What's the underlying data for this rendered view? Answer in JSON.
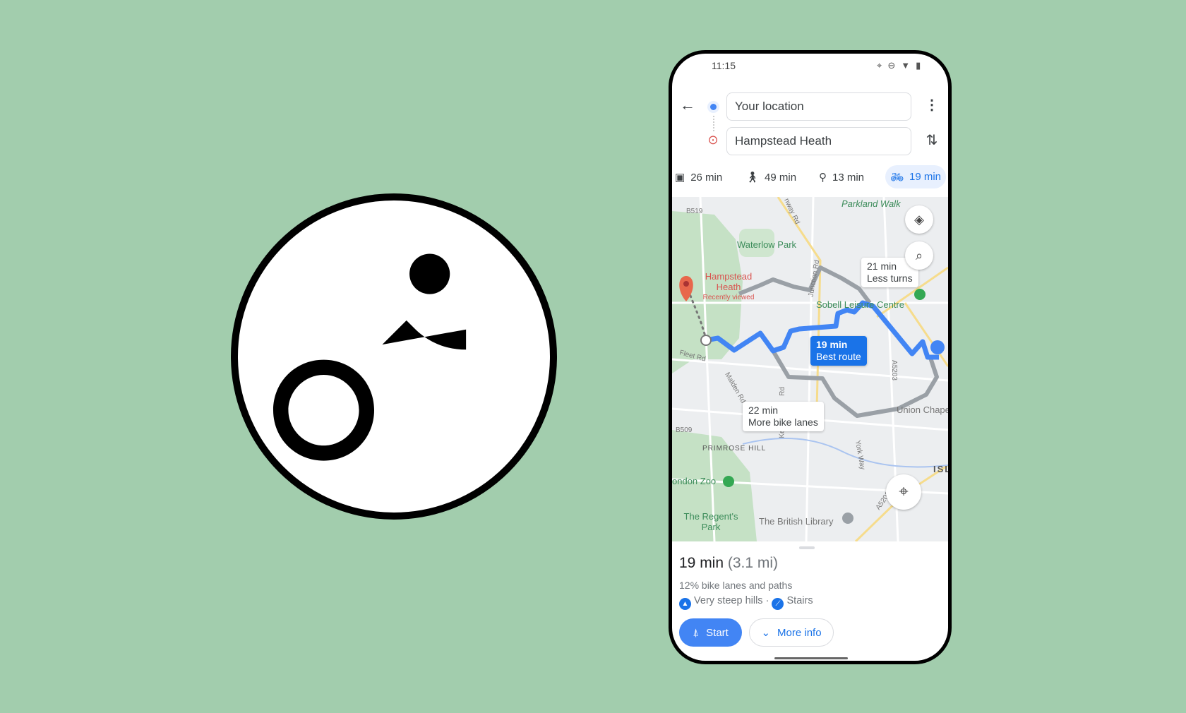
{
  "badge": {
    "icon": "bicycle-icon"
  },
  "phone": {
    "status_bar": {
      "time": "11:15",
      "icons": [
        "location-icon",
        "do-not-disturb-icon",
        "wifi-icon",
        "battery-icon"
      ]
    },
    "search": {
      "origin": "Your location",
      "destination": "Hampstead Heath"
    },
    "modes": [
      {
        "icon": "transit-icon",
        "label": "26 min"
      },
      {
        "icon": "walk-icon",
        "label": "49 min"
      },
      {
        "icon": "rideshare-icon",
        "label": "13 min"
      },
      {
        "icon": "bike-icon",
        "label": "19 min",
        "selected": true
      }
    ],
    "map": {
      "labels": {
        "parkland": "Parkland Walk",
        "waterlow": "Waterlow Park",
        "hampstead": "Hampstead Heath",
        "recent": "Recently viewed",
        "sobell": "Sobell Leisure Centre",
        "fleet": "Fleet Rd",
        "junction": "Junction Rd",
        "malden": "Malden Rd",
        "a5203": "A5203",
        "york": "York Way",
        "union": "Union Chape",
        "b519": "B519",
        "b509": "B509",
        "primrose": "PRIMROSE HILL",
        "zoo": "ondon Zoo",
        "regents": "The Regent's Park",
        "library": "The British Library",
        "isl": "ISL",
        "archway": "nway Rd",
        "rd": "Rd",
        "kentish": "Ke"
      },
      "routes": [
        {
          "time": "21 min",
          "desc": "Less turns"
        },
        {
          "time": "19 min",
          "desc": "Best route",
          "best": true
        },
        {
          "time": "22 min",
          "desc": "More bike lanes"
        }
      ],
      "route_color": "#4285f4",
      "alt_route_color": "#9aa0a6"
    },
    "sheet": {
      "time": "19 min",
      "distance": "(3.1 mi)",
      "bike_lanes": "12% bike lanes and paths",
      "warning1": "Very steep hills",
      "sep": "·",
      "warning2": "Stairs",
      "start": "Start",
      "more_info": "More info"
    }
  },
  "colors": {
    "background": "#a2cdad",
    "accent": "#1a73e8"
  }
}
